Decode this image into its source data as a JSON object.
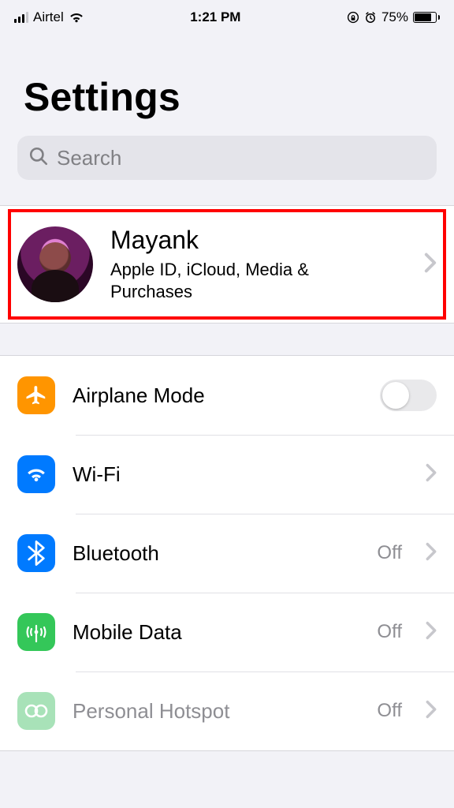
{
  "status_bar": {
    "carrier": "Airtel",
    "time": "1:21 PM",
    "battery_pct": "75%"
  },
  "header": {
    "title": "Settings"
  },
  "search": {
    "placeholder": "Search"
  },
  "profile": {
    "name": "Mayank",
    "subtitle": "Apple ID, iCloud, Media & Purchases"
  },
  "rows": {
    "airplane": {
      "label": "Airplane Mode",
      "toggle": "off"
    },
    "wifi": {
      "label": "Wi-Fi",
      "value": ""
    },
    "bluetooth": {
      "label": "Bluetooth",
      "value": "Off"
    },
    "mobile_data": {
      "label": "Mobile Data",
      "value": "Off"
    },
    "hotspot": {
      "label": "Personal Hotspot",
      "value": "Off"
    }
  }
}
